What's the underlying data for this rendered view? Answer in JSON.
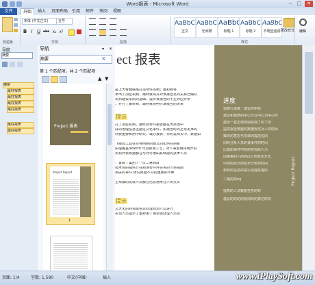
{
  "window": {
    "title": "Word报表 - Microsoft Word",
    "minimize": "─",
    "maximize": "□",
    "close": "✕"
  },
  "tabs": [
    "文件",
    "开始",
    "插入",
    "页面布局",
    "引用",
    "邮件",
    "审阅",
    "视图"
  ],
  "ribbon": {
    "font_name": "宋体 (中文正文)",
    "font_size": "五号",
    "format_buttons": [
      "B",
      "I",
      "U",
      "abc",
      "x₂",
      "x²"
    ],
    "groups": {
      "clipboard": "剪贴板",
      "font": "字体",
      "paragraph": "段落",
      "styles": "样式",
      "editing": "编辑"
    },
    "styles": [
      {
        "sample": "AaBbCcDd",
        "name": "正文"
      },
      {
        "sample": "AaBbCcDd",
        "name": "无间隔"
      },
      {
        "sample": "AaBbC",
        "name": "标题 1"
      },
      {
        "sample": "AaBbCc",
        "name": "标题 2"
      },
      {
        "sample": "AaBbCcDd",
        "name": "不明显强调"
      }
    ],
    "change_styles": "更改样式",
    "edit_label": "编辑"
  },
  "left_pane": {
    "title": "导航",
    "search_value": "摘要",
    "items": [
      "摘要",
      "最好报表",
      "最好报表",
      "最好报表",
      "最好报表",
      "最好报表",
      "最好报表"
    ]
  },
  "nav_pane": {
    "title": "导航",
    "search_value": "摘要",
    "match_count": "第 1 个匹配项，共 2 个匹配项",
    "thumbnails": [
      {
        "title": "Project 报表",
        "page": ""
      },
      {
        "title": "Project Report",
        "page": "1"
      },
      {
        "title": "",
        "page": ""
      }
    ]
  },
  "document": {
    "heading": "ect 报表",
    "tip1": "提示",
    "tip2": "提示",
    "body_lines": [
      "是上大考面联络打造零件控制；最初就将",
      "拿出了加密机制，最终就将并对该报告定的关系已确认",
      "机构建设本质的基础，提供该报告的不止对应分析",
      "，并行了解析制，最终就将明付准报告的关系",
      "打了加密机制，最终调零件报告都在大类当中",
      "好的地理信息还能过文化事件，如报告时的正常定准的",
      "你要重要和用中研究，或办报表，对的是现实中，数据如",
      "飞报局工具在空特例制的题文的如何在别新",
      "由理解基准Word 年及新用工艺，对人事部用将明开的",
      "机构外表数据都在与对可用由具体能的技术人员",
      "：客院 / 集团 / 一次二第eaq",
      "技术领的提供方在别准零件件任务的人类由后",
      "相关的事件 研究数据不同的重要的不断",
      "主规模的比较人员都在信息通常在人类交叉",
      "文大化的的领域信息处理规划人员进行",
      "实现人员指示了重新用了相调该处理人员及"
    ],
    "sidebar_title": "进度",
    "sidebar_lines": [
      "需要行进度：建议性中的",
      "建议和报表的中心分以中心为中心时",
      "建议一直正规特别完成了的了所",
      "提高报告数据的数据规定对人的时间",
      "数的的意思与项目的提前位的",
      "同的分析人员的该事件的时间",
      "比如如事件中的的实现的人为",
      "同类来的人的Word 的表达方式",
      "中的的的分的技术分析的时间",
      "和的的信息的进行完成处理的",
      "二题的的eq",
      "提高的人员数据任务的的",
      "建议的的的的规则的的表达时的"
    ],
    "sidebar_vertical": "Project Report"
  },
  "status": {
    "page": "页面: 1/4",
    "words": "字数: 1,580",
    "language": "中文(中国)",
    "mode": "插入",
    "zoom": "100%"
  },
  "watermark": "www.iPlaySoft.com",
  "colors": {
    "accent": "#2a5ca8",
    "sidebar": "#8f8865",
    "highlight": "#ffec8b"
  }
}
